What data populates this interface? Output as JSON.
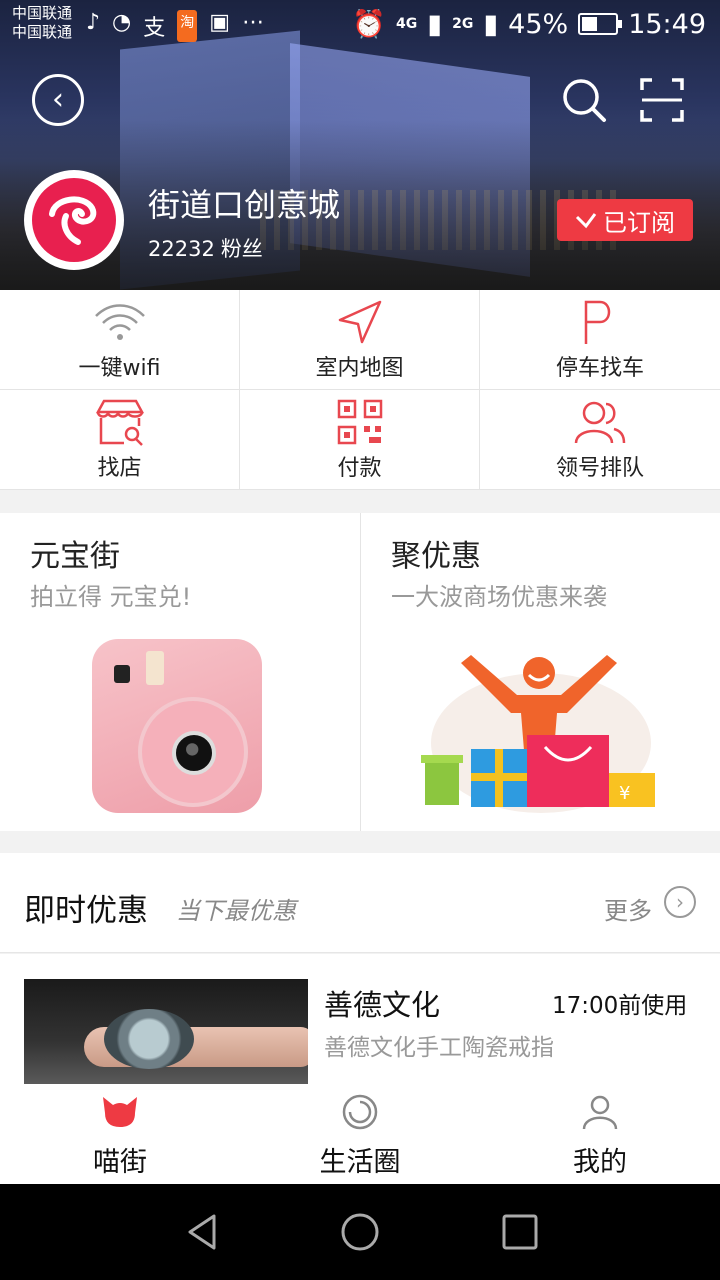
{
  "status_bar": {
    "carrier_1": "中国联通",
    "carrier_2": "中国联通",
    "net_1": "4G",
    "net_2": "2G",
    "battery": "45%",
    "time": "15:49",
    "left_icons": [
      "music-note-icon",
      "qq-icon",
      "alipay-icon",
      "taobao-icon",
      "image-icon",
      "more-dots-icon"
    ]
  },
  "header": {
    "mall_name": "街道口创意城",
    "fans_count": "22232",
    "fans_label": "粉丝",
    "subscribe_label": "已订阅"
  },
  "quick_grid": [
    {
      "label": "一键wifi",
      "icon": "wifi-icon"
    },
    {
      "label": "室内地图",
      "icon": "navigation-arrow-icon"
    },
    {
      "label": "停车找车",
      "icon": "parking-icon"
    },
    {
      "label": "找店",
      "icon": "store-search-icon"
    },
    {
      "label": "付款",
      "icon": "qr-code-icon"
    },
    {
      "label": "领号排队",
      "icon": "users-icon"
    }
  ],
  "promos": [
    {
      "title": "元宝街",
      "subtitle": "拍立得 元宝兑!"
    },
    {
      "title": "聚优惠",
      "subtitle": "一大波商场优惠来袭"
    }
  ],
  "deals": {
    "title": "即时优惠",
    "subtitle": "当下最优惠",
    "more_label": "更多",
    "items": [
      {
        "name": "善德文化",
        "time": "17:00前使用",
        "desc": "善德文化手工陶瓷戒指"
      }
    ]
  },
  "tabbar": [
    {
      "label": "喵街",
      "icon": "cat-icon",
      "active": true
    },
    {
      "label": "生活圈",
      "icon": "circle-icon",
      "active": false
    },
    {
      "label": "我的",
      "icon": "user-icon",
      "active": false
    }
  ],
  "colors": {
    "accent": "#ee3a43",
    "brand": "#e8204f"
  }
}
